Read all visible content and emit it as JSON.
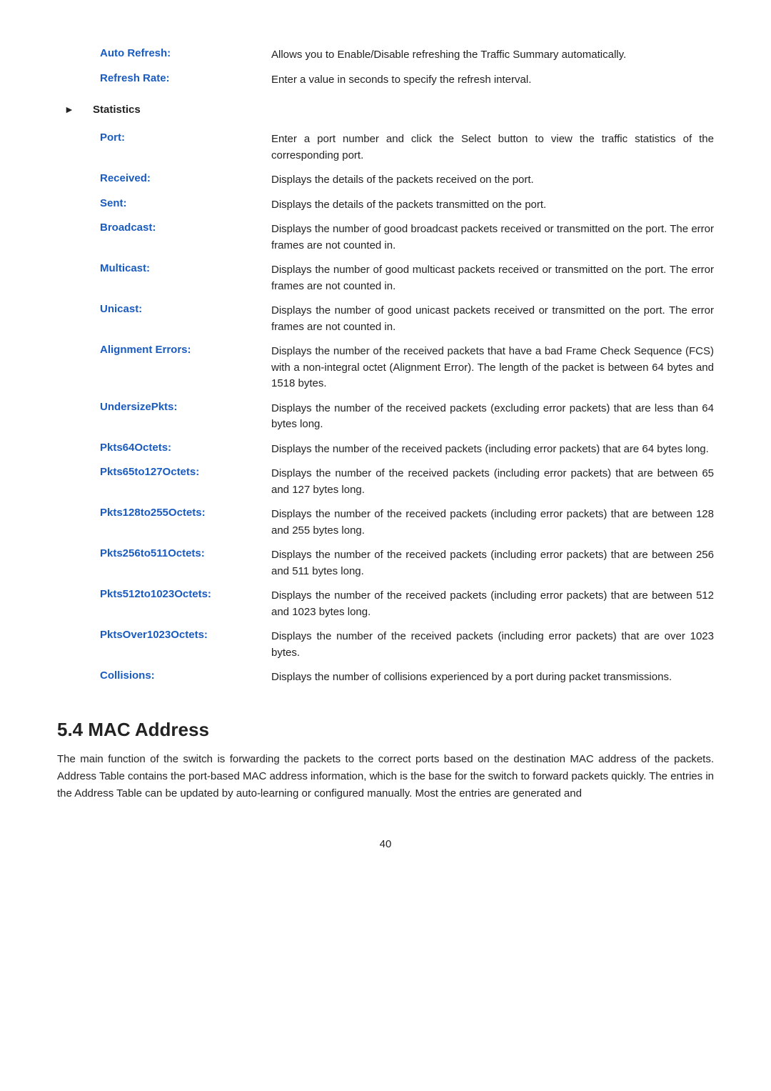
{
  "fields": [
    {
      "label": "Auto Refresh:",
      "desc": "Allows you to Enable/Disable refreshing the Traffic Summary automatically."
    },
    {
      "label": "Refresh Rate:",
      "desc": "Enter a value in seconds to specify the refresh interval."
    }
  ],
  "statistics_section": {
    "title": "Statistics",
    "items": [
      {
        "label": "Port:",
        "desc": "Enter a port number and click the Select button to view the traffic statistics of the corresponding port."
      },
      {
        "label": "Received:",
        "desc": "Displays the details of the packets received on the port."
      },
      {
        "label": "Sent:",
        "desc": "Displays the details of the packets transmitted on the port."
      },
      {
        "label": "Broadcast:",
        "desc": "Displays the number of good broadcast packets received or transmitted on the port. The error frames are not counted in."
      },
      {
        "label": "Multicast:",
        "desc": "Displays the number of good multicast packets received or transmitted on the port. The error frames are not counted in."
      },
      {
        "label": "Unicast:",
        "desc": "Displays the number of good unicast packets received or transmitted on the port. The error frames are not counted in."
      },
      {
        "label": "Alignment Errors:",
        "desc": "Displays the number of the received packets that have a bad Frame Check Sequence (FCS) with a non-integral octet (Alignment Error). The length of the packet is between 64 bytes and 1518 bytes."
      },
      {
        "label": "UndersizePkts:",
        "desc": "Displays the number of the received packets (excluding error packets) that are less than 64 bytes long."
      },
      {
        "label": "Pkts64Octets:",
        "desc": "Displays the number of the received packets (including error packets) that are 64 bytes long."
      },
      {
        "label": "Pkts65to127Octets:",
        "desc": "Displays the number of the received packets (including error packets) that are between 65 and 127 bytes long."
      },
      {
        "label": "Pkts128to255Octets:",
        "desc": "Displays the number of the received packets (including error packets) that are between 128 and 255 bytes long."
      },
      {
        "label": "Pkts256to511Octets:",
        "desc": "Displays the number of the received packets (including error packets) that are between 256 and 511 bytes long."
      },
      {
        "label": "Pkts512to1023Octets:",
        "desc": "Displays the number of the received packets (including error packets) that are between 512 and 1023 bytes long."
      },
      {
        "label": "PktsOver1023Octets:",
        "desc": "Displays the number of the received packets (including error packets) that are over 1023 bytes."
      },
      {
        "label": "Collisions:",
        "desc": "Displays the number of collisions experienced by a port during packet transmissions."
      }
    ]
  },
  "mac_address": {
    "section_number": "5.4",
    "title": "MAC Address",
    "body": "The main function of the switch is forwarding the packets to the correct ports based on the destination MAC address of the packets. Address Table contains the port-based MAC address information, which is the base for the switch to forward packets quickly. The entries in the Address Table can be updated by auto-learning or configured manually. Most the entries are generated and"
  },
  "page_number": "40"
}
